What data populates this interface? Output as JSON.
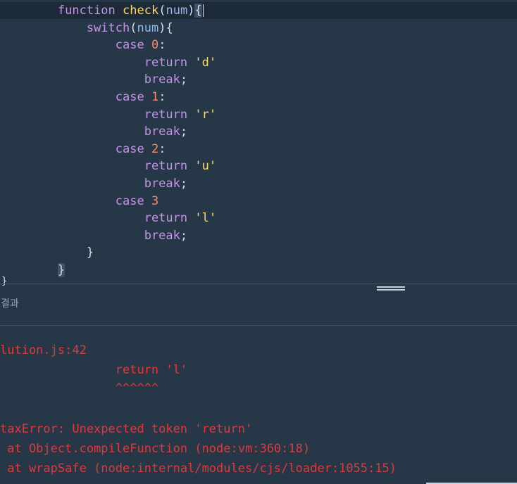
{
  "editor": {
    "lines": [
      {
        "indent": "        ",
        "tokens": [
          [
            "kw",
            "function"
          ],
          [
            "par",
            " "
          ],
          [
            "fn",
            "check"
          ],
          [
            "par",
            "("
          ],
          [
            "var",
            "num"
          ],
          [
            "par",
            ")"
          ]
        ],
        "brace": "{",
        "active": true
      },
      {
        "indent": "            ",
        "tokens": [
          [
            "kw",
            "switch"
          ],
          [
            "par",
            "("
          ],
          [
            "var",
            "num"
          ],
          [
            "par",
            "){"
          ]
        ]
      },
      {
        "indent": "                ",
        "tokens": [
          [
            "kw",
            "case"
          ],
          [
            "par",
            " "
          ],
          [
            "num",
            "0"
          ],
          [
            "par",
            ":"
          ]
        ]
      },
      {
        "indent": "                    ",
        "tokens": [
          [
            "kw",
            "return"
          ],
          [
            "par",
            " "
          ],
          [
            "str",
            "'d'"
          ]
        ]
      },
      {
        "indent": "                    ",
        "tokens": [
          [
            "kw",
            "break"
          ],
          [
            "par",
            ";"
          ]
        ]
      },
      {
        "indent": "                ",
        "tokens": [
          [
            "kw",
            "case"
          ],
          [
            "par",
            " "
          ],
          [
            "num",
            "1"
          ],
          [
            "par",
            ":"
          ]
        ]
      },
      {
        "indent": "                    ",
        "tokens": [
          [
            "kw",
            "return"
          ],
          [
            "par",
            " "
          ],
          [
            "str",
            "'r'"
          ]
        ]
      },
      {
        "indent": "                    ",
        "tokens": [
          [
            "kw",
            "break"
          ],
          [
            "par",
            ";"
          ]
        ]
      },
      {
        "indent": "                ",
        "tokens": [
          [
            "kw",
            "case"
          ],
          [
            "par",
            " "
          ],
          [
            "num",
            "2"
          ],
          [
            "par",
            ":"
          ]
        ]
      },
      {
        "indent": "                    ",
        "tokens": [
          [
            "kw",
            "return"
          ],
          [
            "par",
            " "
          ],
          [
            "str",
            "'u'"
          ]
        ]
      },
      {
        "indent": "                    ",
        "tokens": [
          [
            "kw",
            "break"
          ],
          [
            "par",
            ";"
          ]
        ]
      },
      {
        "indent": "                ",
        "tokens": [
          [
            "kw",
            "case"
          ],
          [
            "par",
            " "
          ],
          [
            "num",
            "3"
          ]
        ]
      },
      {
        "indent": "                    ",
        "tokens": [
          [
            "kw",
            "return"
          ],
          [
            "par",
            " "
          ],
          [
            "str",
            "'l'"
          ]
        ]
      },
      {
        "indent": "                    ",
        "tokens": [
          [
            "kw",
            "break"
          ],
          [
            "par",
            ";"
          ]
        ]
      },
      {
        "indent": "            ",
        "tokens": [
          [
            "par",
            "}"
          ]
        ]
      },
      {
        "indent": "        ",
        "tokens": [],
        "brace": "}"
      }
    ],
    "cutoff_char": "}"
  },
  "result": {
    "label": "결과",
    "output_lines": [
      "lution.js:42",
      "                return 'l'",
      "                ^^^^^^",
      "",
      "taxError: Unexpected token 'return'",
      " at Object.compileFunction (node:vm:360:18)",
      " at wrapSafe (node:internal/modules/cjs/loader:1055:15)"
    ]
  }
}
